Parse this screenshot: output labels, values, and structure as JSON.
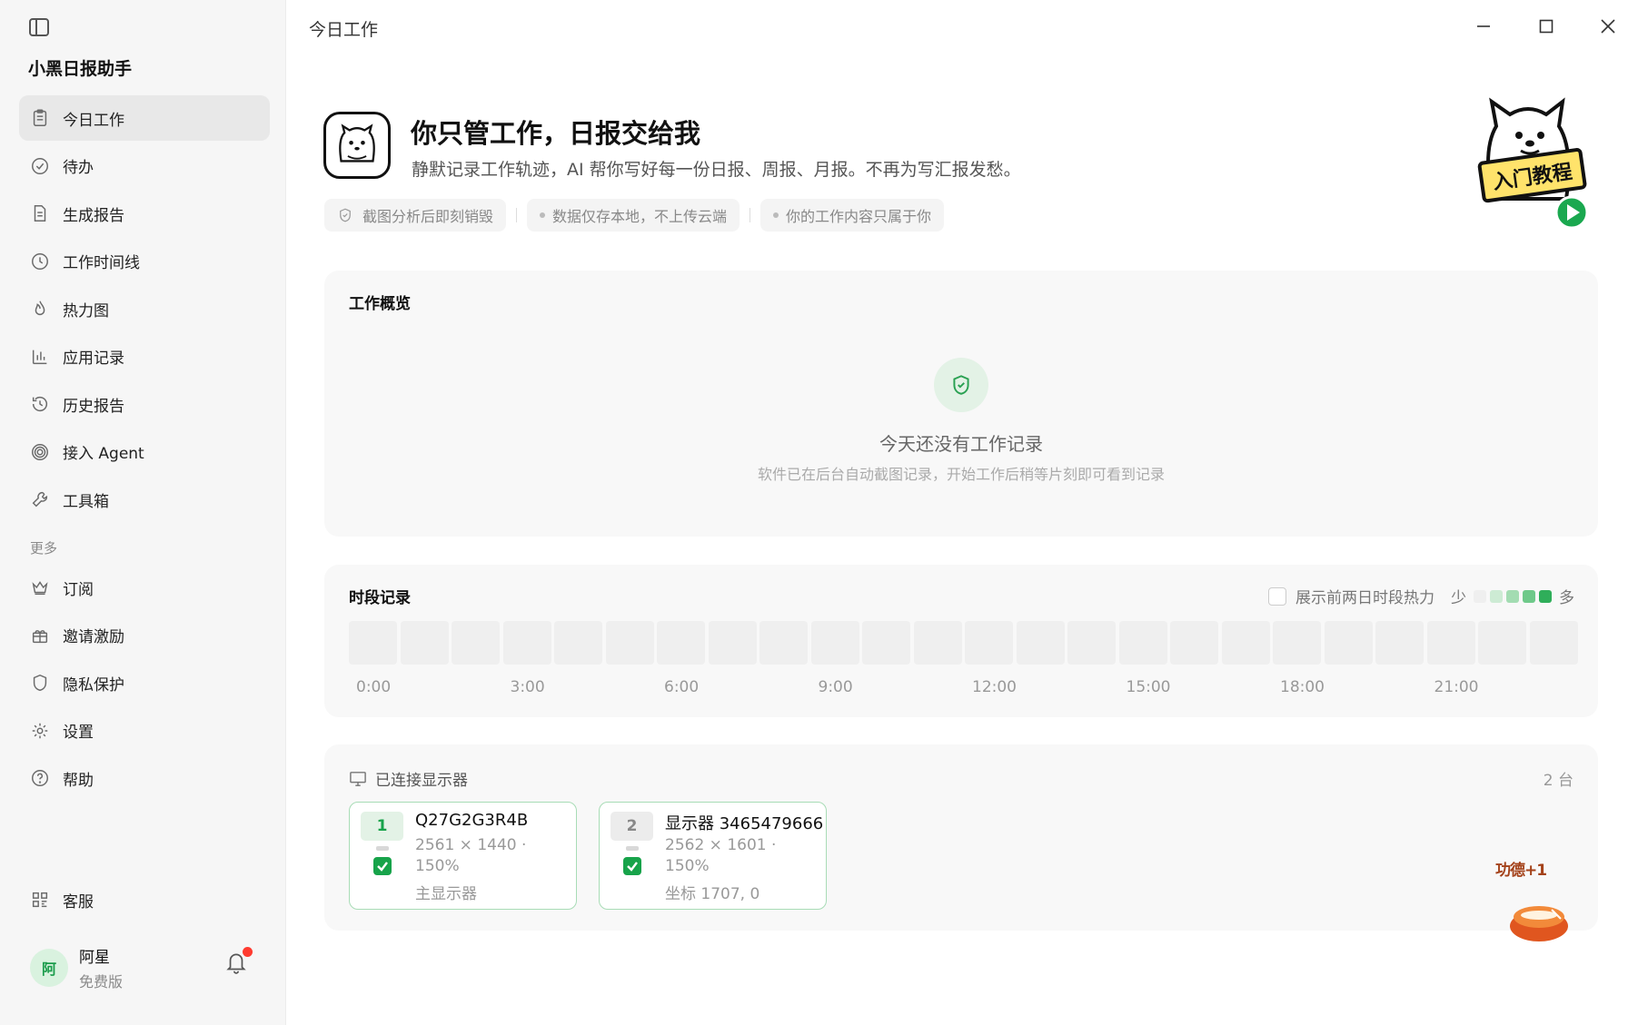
{
  "window": {
    "title": "今日工作"
  },
  "app": {
    "name": "小黑日报助手"
  },
  "sidebar": {
    "items": [
      {
        "label": "今日工作",
        "icon": "clipboard-icon",
        "active": true
      },
      {
        "label": "待办",
        "icon": "check-circle-icon"
      },
      {
        "label": "生成报告",
        "icon": "document-icon"
      },
      {
        "label": "工作时间线",
        "icon": "clock-icon"
      },
      {
        "label": "热力图",
        "icon": "flame-icon"
      },
      {
        "label": "应用记录",
        "icon": "bar-chart-icon"
      },
      {
        "label": "历史报告",
        "icon": "history-icon"
      },
      {
        "label": "接入 Agent",
        "icon": "spiral-icon"
      },
      {
        "label": "工具箱",
        "icon": "wrench-icon"
      }
    ],
    "more_label": "更多",
    "more_items": [
      {
        "label": "订阅",
        "icon": "crown-icon"
      },
      {
        "label": "邀请激励",
        "icon": "gift-icon"
      },
      {
        "label": "隐私保护",
        "icon": "shield-icon"
      },
      {
        "label": "设置",
        "icon": "gear-icon"
      },
      {
        "label": "帮助",
        "icon": "help-circle-icon"
      }
    ],
    "service_label": "客服",
    "user": {
      "avatar_text": "阿",
      "name": "阿星",
      "plan": "免费版"
    }
  },
  "hero": {
    "title": "你只管工作，日报交给我",
    "subtitle": "静默记录工作轨迹，AI 帮你写好每一份日报、周报、月报。不再为写汇报发愁。",
    "chips": [
      "截图分析后即刻销毁",
      "数据仅存本地，不上传云端",
      "你的工作内容只属于你"
    ],
    "tutorial_label": "入门教程"
  },
  "overview": {
    "title": "工作概览",
    "empty_title": "今天还没有工作记录",
    "empty_subtitle": "软件已在后台自动截图记录，开始工作后稍等片刻即可看到记录"
  },
  "timeline": {
    "title": "时段记录",
    "toggle_label": "展示前两日时段热力",
    "legend_less": "少",
    "legend_more": "多",
    "legend_colors": [
      "#efefef",
      "#cdebd4",
      "#a3dcb2",
      "#6fc98a",
      "#2fae5a"
    ],
    "slot_count": 24,
    "ticks": [
      "0:00",
      "3:00",
      "6:00",
      "9:00",
      "12:00",
      "15:00",
      "18:00",
      "21:00"
    ]
  },
  "monitors": {
    "title": "已连接显示器",
    "count": "2 台",
    "items": [
      {
        "index": "1",
        "name": "Q27G2G3R4B",
        "resolution": "2561 × 1440 ·",
        "scale": "150%",
        "note": "主显示器",
        "primary": true
      },
      {
        "index": "2",
        "name": "显示器 3465479666",
        "resolution": "2562 × 1601 ·",
        "scale": "150%",
        "note": "坐标 1707, 0",
        "primary": false
      }
    ]
  },
  "floating": {
    "badge": "功德+1"
  },
  "colors": {
    "accent": "#17a34a",
    "accent_light": "#e3f2e6",
    "sidebar_bg": "#f6f6f6",
    "card_bg": "#f8f8f8"
  }
}
